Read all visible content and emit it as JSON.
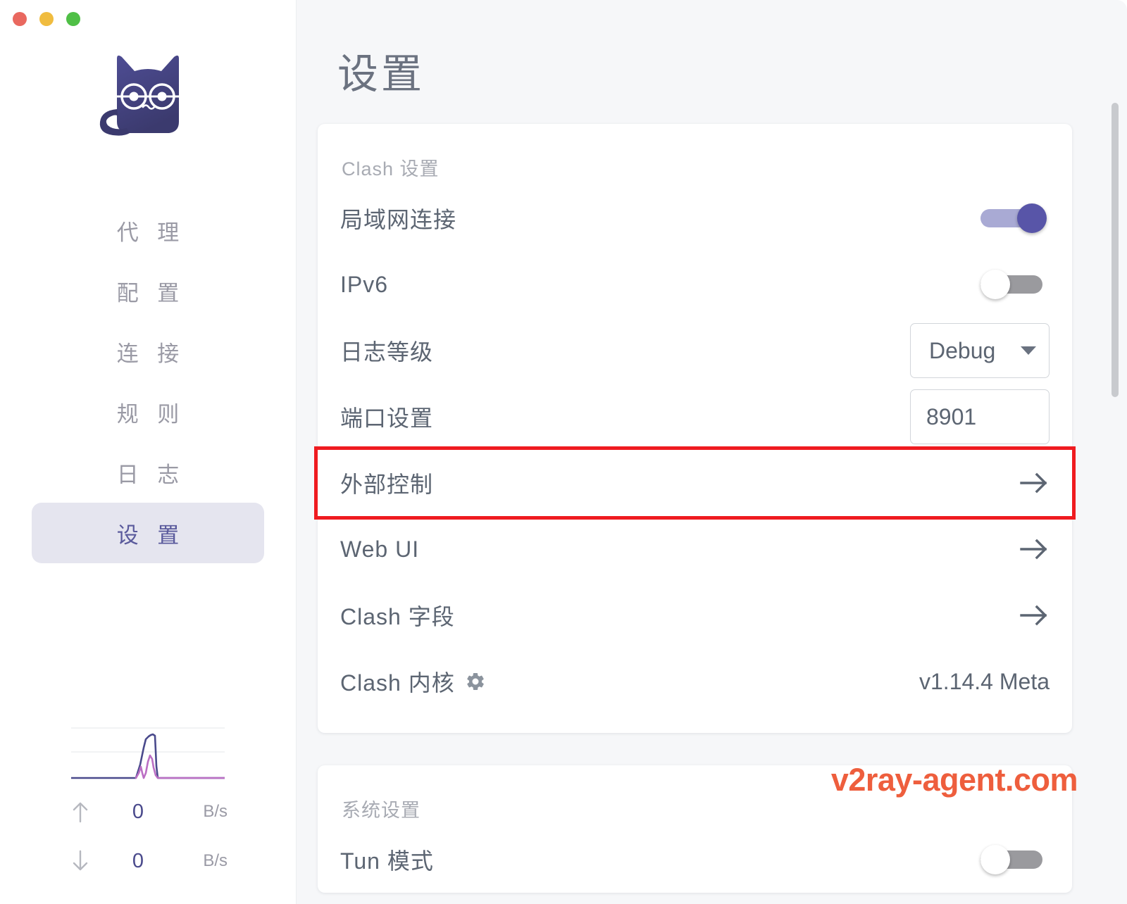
{
  "window": {
    "controls": [
      "close",
      "minimize",
      "maximize"
    ]
  },
  "sidebar": {
    "logo_alt": "cat-logo",
    "items": [
      {
        "label": "代 理",
        "active": false
      },
      {
        "label": "配 置",
        "active": false
      },
      {
        "label": "连 接",
        "active": false
      },
      {
        "label": "规 则",
        "active": false
      },
      {
        "label": "日 志",
        "active": false
      },
      {
        "label": "设 置",
        "active": true
      }
    ],
    "traffic": {
      "upload_value": "0",
      "upload_unit": "B/s",
      "download_value": "0",
      "download_unit": "B/s",
      "upload_arrow": "↑",
      "download_arrow": "↓"
    }
  },
  "main": {
    "page_title": "设置",
    "watermark": "v2ray-agent.com",
    "cards": [
      {
        "label": "Clash 设置",
        "rows": [
          {
            "label": "局域网连接",
            "control": "switch",
            "state": "on"
          },
          {
            "label": "IPv6",
            "control": "switch",
            "state": "off"
          },
          {
            "label": "日志等级",
            "control": "select",
            "value": "Debug"
          },
          {
            "label": "端口设置",
            "control": "input",
            "value": "8901"
          },
          {
            "label": "外部控制",
            "control": "arrow",
            "highlighted": true
          },
          {
            "label": "Web UI",
            "control": "arrow"
          },
          {
            "label": "Clash 字段",
            "control": "arrow"
          },
          {
            "label": "Clash 内核",
            "control": "text",
            "icon": "gear-icon",
            "value": "v1.14.4 Meta"
          }
        ]
      },
      {
        "label": "系统设置",
        "rows": [
          {
            "label": "Tun 模式",
            "control": "switch",
            "state": "off"
          }
        ]
      }
    ]
  },
  "colors": {
    "accent": "#5855a8",
    "accent_light": "#a9aad4",
    "active_nav_bg": "#e5e5ef",
    "highlight_border": "#ef1b20",
    "watermark": "#ee5e3d",
    "traffic_light_close": "#e9685f",
    "traffic_light_min": "#f0bc3f",
    "traffic_light_max": "#4fbf46"
  }
}
